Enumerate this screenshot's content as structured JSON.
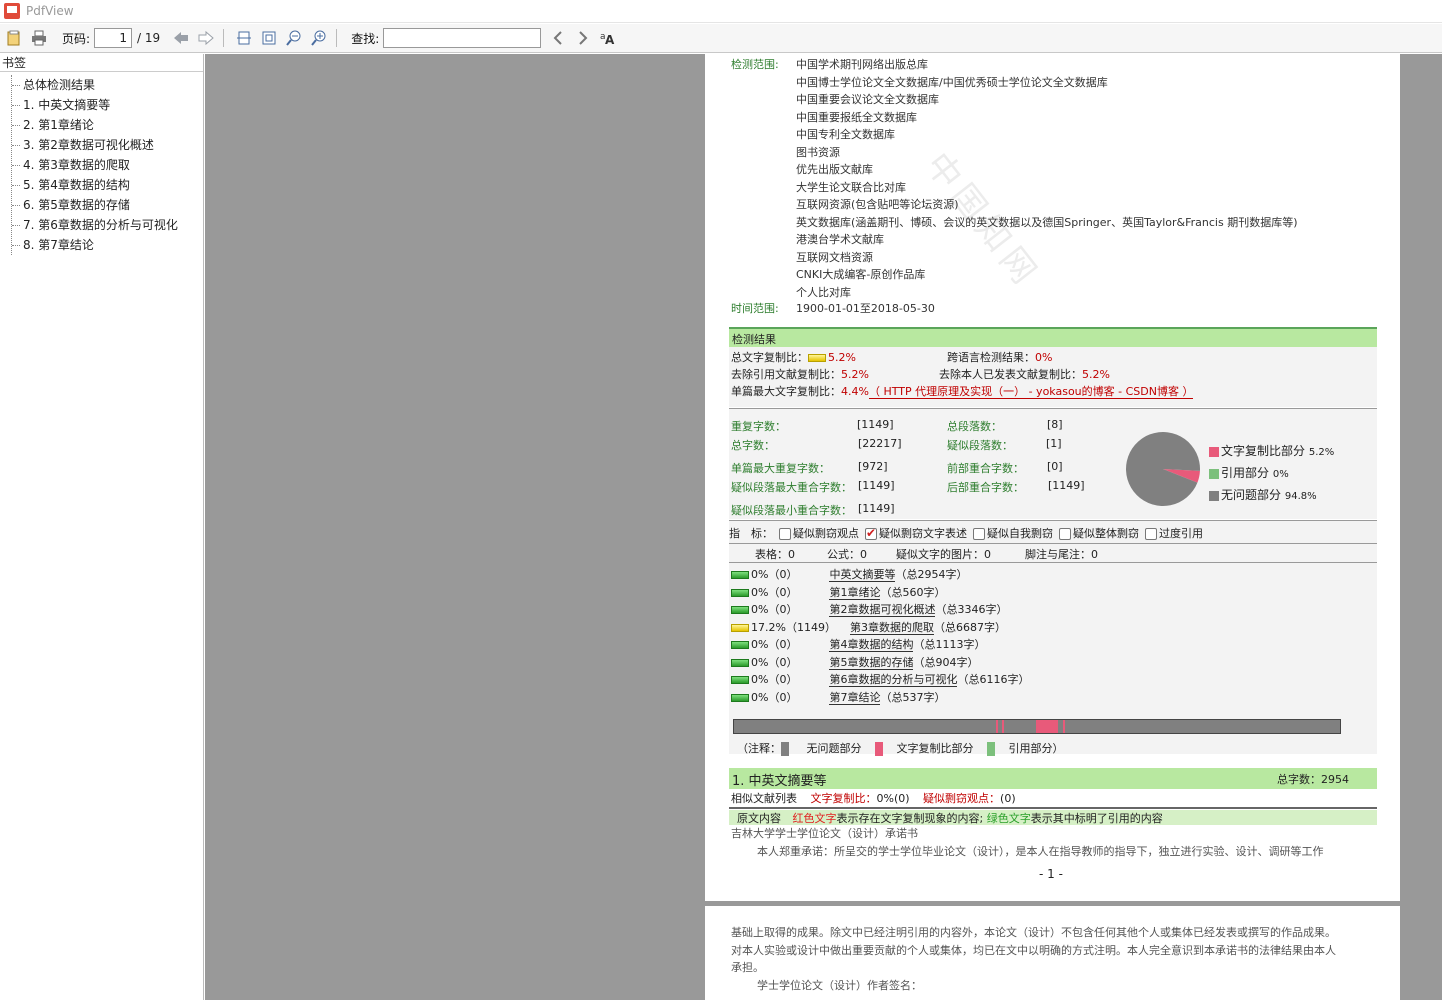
{
  "app": {
    "title": "PdfView"
  },
  "toolbar": {
    "page_label": "页码:",
    "current_page": "1",
    "total_pages": "/ 19",
    "find_label": "查找:",
    "find_value": ""
  },
  "sidebar": {
    "header": "书签",
    "items": [
      "总体检测结果",
      "1. 中英文摘要等",
      "2. 第1章绪论",
      "3. 第2章数据可视化概述",
      "4. 第3章数据的爬取",
      "5. 第4章数据的结构",
      "6. 第5章数据的存储",
      "7. 第6章数据的分析与可视化",
      "8. 第7章结论"
    ]
  },
  "page1": {
    "scope_label": "检测范围:",
    "sources": [
      "中国学术期刊网络出版总库",
      "中国博士学位论文全文数据库/中国优秀硕士学位论文全文数据库",
      "中国重要会议论文全文数据库",
      "中国重要报纸全文数据库",
      "中国专利全文数据库",
      "图书资源",
      "优先出版文献库",
      "大学生论文联合比对库",
      "互联网资源(包含贴吧等论坛资源)",
      "英文数据库(涵盖期刊、博硕、会议的英文数据以及德国Springer、英国Taylor&Francis 期刊数据库等)",
      "港澳台学术文献库",
      "互联网文档资源",
      "CNKI大成编客-原创作品库",
      "个人比对库"
    ],
    "time_label": "时间范围:",
    "time_value": "1900-01-01至2018-05-30",
    "watermark": "中国知网",
    "results_title": "检测结果",
    "total_copy_label": "总文字复制比：",
    "total_copy_value": "5.2%",
    "cross_lang_label": "跨语言检测结果：",
    "cross_lang_value": "0%",
    "excl_ref_label": "去除引用文献复制比：",
    "excl_ref_value": "5.2%",
    "excl_self_label": "去除本人已发表文献复制比：",
    "excl_self_value": "5.2%",
    "single_max_label": "单篇最大文字复制比：",
    "single_max_value": "4.4%",
    "single_max_source": "（ HTTP 代理原理及实现（一） - yokasou的博客 - CSDN博客 ）",
    "stats": {
      "repeat_chars_label": "重复字数：",
      "repeat_chars_value": "[1149]",
      "total_paras_label": "总段落数：",
      "total_paras_value": "[8]",
      "total_chars_label": "总字数：",
      "total_chars_value": "[22217]",
      "suspect_paras_label": "疑似段落数：",
      "suspect_paras_value": "[1]",
      "single_max_repeat_label": "单篇最大重复字数：",
      "single_max_repeat_value": "[972]",
      "front_overlap_label": "前部重合字数：",
      "front_overlap_value": "[0]",
      "para_max_overlap_label": "疑似段落最大重合字数：",
      "para_max_overlap_value": "[1149]",
      "back_overlap_label": "后部重合字数：",
      "back_overlap_value": "[1149]",
      "para_min_overlap_label": "疑似段落最小重合字数：",
      "para_min_overlap_value": "[1149]"
    },
    "indicators_label": "指　标：",
    "indicators": [
      {
        "label": "疑似剽窃观点",
        "checked": false
      },
      {
        "label": "疑似剽窃文字表述",
        "checked": true
      },
      {
        "label": "疑似自我剽窃",
        "checked": false
      },
      {
        "label": "疑似整体剽窃",
        "checked": false
      },
      {
        "label": "过度引用",
        "checked": false
      }
    ],
    "counts_line": [
      {
        "label": "表格：",
        "value": "0"
      },
      {
        "label": "公式：",
        "value": "0"
      },
      {
        "label": "疑似文字的图片：",
        "value": "0"
      },
      {
        "label": "脚注与尾注：",
        "value": "0"
      }
    ],
    "chapters": [
      {
        "pct": "0%（0）",
        "name": "中英文摘要等",
        "total": "（总2954字）",
        "level": "green"
      },
      {
        "pct": "0%（0）",
        "name": "第1章绪论",
        "total": "（总560字）",
        "level": "green"
      },
      {
        "pct": "0%（0）",
        "name": "第2章数据可视化概述",
        "total": "（总3346字）",
        "level": "green"
      },
      {
        "pct": "17.2%（1149）",
        "name": "第3章数据的爬取",
        "total": "（总6687字）",
        "level": "yellow"
      },
      {
        "pct": "0%（0）",
        "name": "第4章数据的结构",
        "total": "（总1113字）",
        "level": "green"
      },
      {
        "pct": "0%（0）",
        "name": "第5章数据的存储",
        "total": "（总904字）",
        "level": "green"
      },
      {
        "pct": "0%（0）",
        "name": "第6章数据的分析与可视化",
        "total": "（总6116字）",
        "level": "green"
      },
      {
        "pct": "0%（0）",
        "name": "第7章结论",
        "total": "（总537字）",
        "level": "green"
      }
    ],
    "legend_note": {
      "prefix": "（注释：",
      "no_problem": "无问题部分",
      "copy": "文字复制比部分",
      "cite": "引用部分",
      "suffix": "）"
    },
    "section1_title": "1. 中英文摘要等",
    "section1_total_label": "总字数：",
    "section1_total_value": "2954",
    "similar_list_label": "相似文献列表",
    "copy_ratio_label": "文字复制比：",
    "copy_ratio_value": "0%(0)",
    "plagiarism_label": "疑似剽窃观点：",
    "plagiarism_value": "(0)",
    "original_label": "原文内容",
    "red_text_label": "红色文字",
    "red_text_desc": "表示存在文字复制现象的内容;",
    "green_text_label": "绿色文字",
    "green_text_desc": "表示其中标明了引用的内容",
    "body_line1": "吉林大学学士学位论文（设计）承诺书",
    "body_line2": "本人郑重承诺：所呈交的学士学位毕业论文（设计），是本人在指导教师的指导下，独立进行实验、设计、调研等工作",
    "page_number": "- 1 -"
  },
  "page2": {
    "line1": "基础上取得的成果。除文中已经注明引用的内容外，本论文（设计）不包含任何其他个人或集体已经发表或撰写的作品成果。",
    "line2": "对本人实验或设计中做出重要贡献的个人或集体，均已在文中以明确的方式注明。本人完全意识到本承诺书的法律结果由本人",
    "line3": "承担。",
    "line4": "学士学位论文（设计）作者签名："
  },
  "chart_data": {
    "type": "pie",
    "labels": [
      "文字复制比部分",
      "引用部分",
      "无问题部分"
    ],
    "values": [
      5.2,
      0,
      94.8
    ],
    "display_values": [
      "5.2%",
      "0%",
      "94.8%"
    ],
    "colors": [
      "#e85a7a",
      "#7cc07c",
      "#808080"
    ],
    "legend": "right"
  },
  "colors": {
    "section_green": "#b8e8a0",
    "accent_red": "#c00000",
    "label_green": "#2d7d2d"
  }
}
